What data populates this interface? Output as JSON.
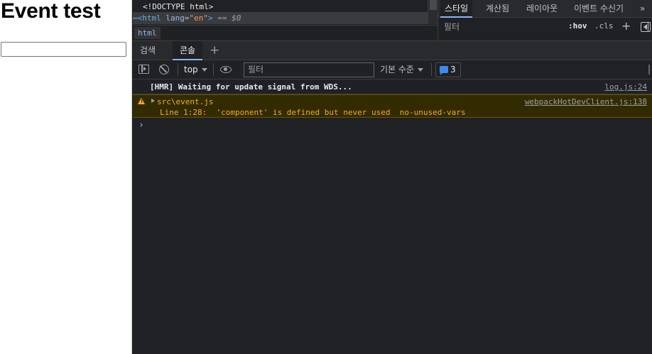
{
  "page": {
    "heading": "Event test",
    "input_value": ""
  },
  "elements_panel": {
    "line1": "<!DOCTYPE html>",
    "line2_dots": "⋯",
    "line2_tag_open": "<html",
    "line2_attr": " lang=",
    "line2_val": "\"en\"",
    "line2_tag_close": ">",
    "line2_eq": " == $0",
    "breadcrumb": "html"
  },
  "styles_panel": {
    "tabs": [
      "스타일",
      "계산됨",
      "레이아웃",
      "이벤트 수신기",
      "»"
    ],
    "filter_placeholder": "필터",
    "hov": ":hov",
    "cls": ".cls",
    "plus": "+"
  },
  "drawer": {
    "tabs": [
      "검색",
      "콘솔"
    ],
    "active_tab": "콘솔",
    "add": "+"
  },
  "console_toolbar": {
    "context": "top",
    "filter_placeholder": "필터",
    "levels": "기본 수준",
    "issues_count": "3"
  },
  "console": {
    "messages": [
      {
        "level": "info",
        "text": "[HMR] Waiting for update signal from WDS...",
        "source": "log.js:24"
      },
      {
        "level": "warning",
        "file": "src\\event.js",
        "detail": "Line 1:28:  'component' is defined but never used  no-unused-vars",
        "source": "webpackHotDevClient.js:138"
      }
    ],
    "prompt": "›"
  },
  "colors": {
    "devtools_bg": "#202124",
    "warning_bg": "#332b00",
    "warning_text": "#f2ab26",
    "accent": "#8ab4f8"
  }
}
